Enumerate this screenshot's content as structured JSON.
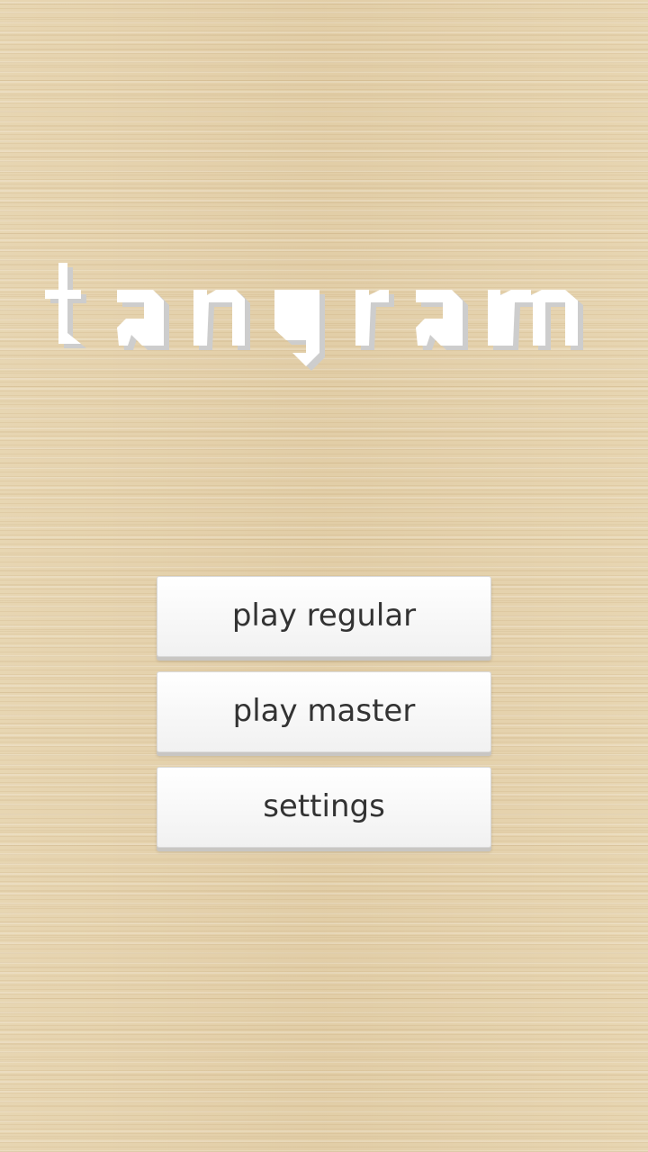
{
  "app": {
    "logo_text": "tangram",
    "logo_color": "#ffffff",
    "logo_shadow_color": "#cfcfcf"
  },
  "menu": {
    "play_regular_label": "play regular",
    "play_master_label": "play master",
    "settings_label": "settings",
    "button_text_color": "#333333"
  },
  "background": {
    "style": "light wood texture",
    "color": "#e6d3ad"
  }
}
